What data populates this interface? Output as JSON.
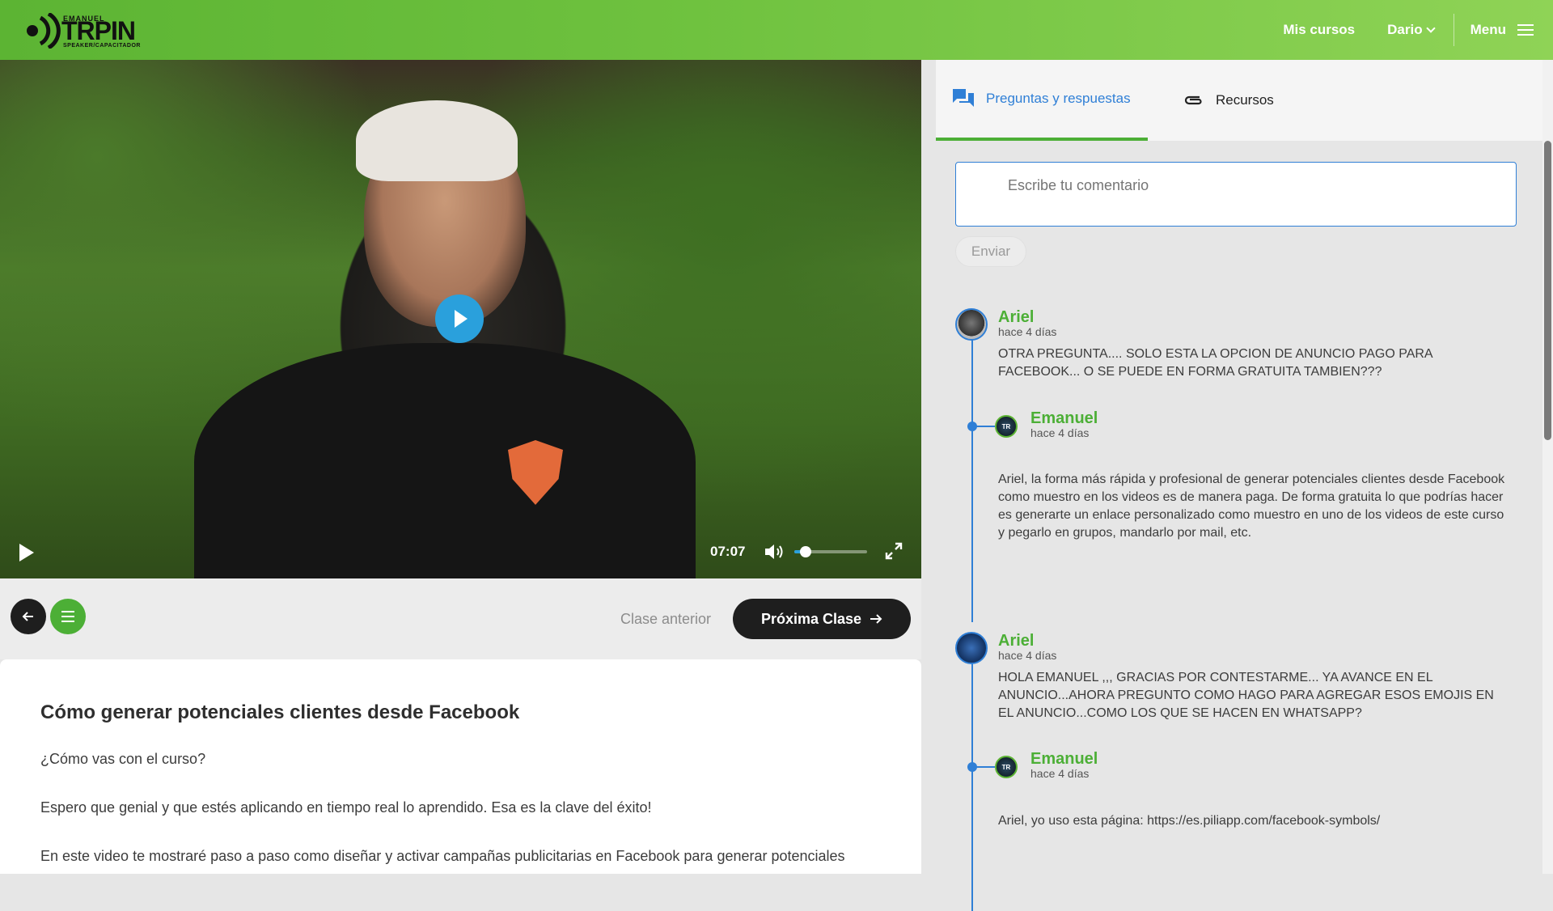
{
  "header": {
    "logo_small": "EMANUEL",
    "logo_big": "TRPIN",
    "logo_sub": "SPEAKER/CAPACITADOR",
    "nav_courses": "Mis cursos",
    "nav_user": "Dario",
    "nav_menu": "Menu"
  },
  "video": {
    "time": "07:07",
    "volume_level": 0.15
  },
  "lesson_nav": {
    "prev_label": "Clase anterior",
    "next_label": "Próxima Clase"
  },
  "lesson": {
    "title": "Cómo generar potenciales clientes desde Facebook",
    "paragraphs": [
      "¿Cómo vas con el curso?",
      "Espero que genial y que estés aplicando en tiempo real lo aprendido. Esa es la clave del éxito!",
      "En este video te mostraré paso a paso como diseñar y activar campañas publicitarias en Facebook para generar potenciales"
    ]
  },
  "sidebar": {
    "tab_qa": "Preguntas y respuestas",
    "tab_resources": "Recursos",
    "comment_placeholder": "Escribe tu comentario",
    "send_label": "Enviar",
    "threads": [
      {
        "author": "Ariel",
        "when": "hace 4 días",
        "text": "OTRA PREGUNTA.... SOLO ESTA LA OPCION DE ANUNCIO PAGO PARA FACEBOOK... O SE PUEDE EN FORMA GRATUITA TAMBIEN???",
        "reply": {
          "author": "Emanuel",
          "when": "hace 4 días",
          "text": "Ariel, la forma más rápida y profesional de generar potenciales clientes desde Facebook como muestro en los videos es de manera paga. De forma gratuita lo que podrías hacer es generarte un enlace personalizado como muestro en uno de los videos de este curso y pegarlo en grupos, mandarlo por mail, etc."
        }
      },
      {
        "author": "Ariel",
        "when": "hace 4 días",
        "text": "HOLA EMANUEL ,,, GRACIAS POR CONTESTARME... YA AVANCE EN EL ANUNCIO...AHORA PREGUNTO COMO HAGO PARA AGREGAR ESOS EMOJIS EN EL ANUNCIO...COMO LOS QUE SE HACEN EN WHATSAPP?",
        "reply": {
          "author": "Emanuel",
          "when": "hace 4 días",
          "text": "Ariel, yo uso esta página: https://es.piliapp.com/facebook-symbols/"
        }
      }
    ]
  }
}
